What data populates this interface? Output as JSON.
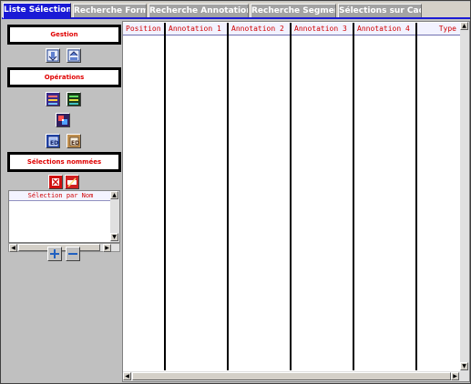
{
  "tabs": [
    {
      "label": "Liste Sélections",
      "active": true
    },
    {
      "label": "Recherche Forme",
      "active": false
    },
    {
      "label": "Recherche Annotation(s)",
      "active": false
    },
    {
      "label": "Recherche Segments",
      "active": false
    },
    {
      "label": "Sélections sur Cadre",
      "active": false
    }
  ],
  "left_panel": {
    "gestion_title": "Gestion",
    "operations_title": "Opérations",
    "selections_nommees_title": "Sélections nommées",
    "name_list": {
      "header": "Sélection par Nom",
      "items": []
    }
  },
  "table": {
    "columns": [
      "Position",
      "Annotation 1",
      "Annotation 2",
      "Annotation 3",
      "Annotation 4",
      "Type"
    ],
    "rows": []
  },
  "colors": {
    "active_tab": "#1a1ad6",
    "header_text": "#d00000",
    "section_text": "#e00000"
  },
  "icons": {
    "gestion": [
      "import-selection-icon",
      "export-selection-icon"
    ],
    "operations": [
      "union-icon",
      "intersection-icon",
      "difference-icon",
      "edit-selection-icon",
      "edit-selection-alt-icon"
    ],
    "named": [
      "delete-named-icon",
      "rename-named-icon"
    ],
    "list_controls": [
      "add-icon",
      "remove-icon"
    ]
  }
}
